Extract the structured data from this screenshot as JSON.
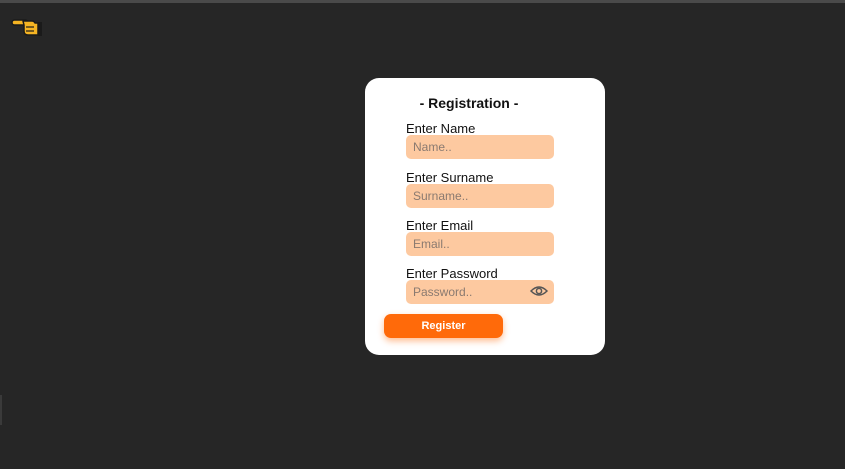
{
  "page": {
    "back_icon": "pointing-hand-left-icon"
  },
  "form": {
    "title": "- Registration -",
    "fields": [
      {
        "label": "Enter Name",
        "placeholder": "Name..",
        "type": "text"
      },
      {
        "label": "Enter Surname",
        "placeholder": "Surname..",
        "type": "text"
      },
      {
        "label": "Enter Email",
        "placeholder": "Email..",
        "type": "email"
      },
      {
        "label": "Enter Password",
        "placeholder": "Password..",
        "type": "password",
        "icon": "eye-icon"
      }
    ],
    "submit_label": "Register"
  },
  "colors": {
    "background": "#262626",
    "card": "#ffffff",
    "input_fill": "#fdc9a0",
    "accent": "#ff6a0a",
    "icon_yellow": "#f5b423"
  }
}
